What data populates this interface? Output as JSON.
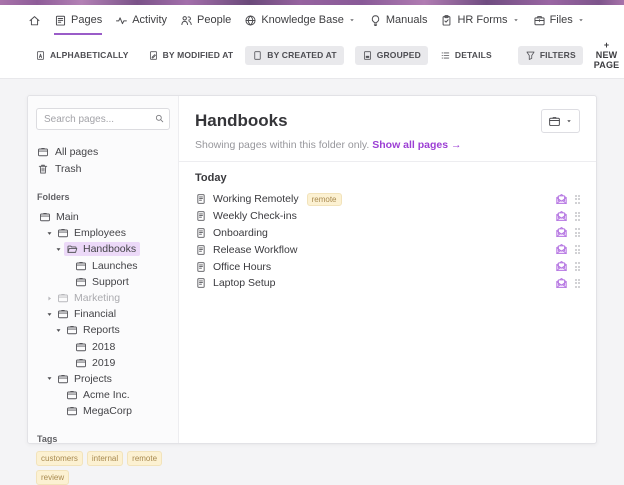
{
  "nav": {
    "items": [
      {
        "icon": "home",
        "label": "",
        "active": false,
        "dropdown": false
      },
      {
        "icon": "pages",
        "label": "Pages",
        "active": true,
        "dropdown": false
      },
      {
        "icon": "activity",
        "label": "Activity",
        "active": false,
        "dropdown": false
      },
      {
        "icon": "people",
        "label": "People",
        "active": false,
        "dropdown": false
      },
      {
        "icon": "globe",
        "label": "Knowledge Base",
        "active": false,
        "dropdown": true
      },
      {
        "icon": "bulb",
        "label": "Manuals",
        "active": false,
        "dropdown": false
      },
      {
        "icon": "clipboard",
        "label": "HR Forms",
        "active": false,
        "dropdown": true
      },
      {
        "icon": "files",
        "label": "Files",
        "active": false,
        "dropdown": true
      }
    ]
  },
  "toolbar": {
    "buttons": [
      {
        "icon": "sort-alpha",
        "label": "ALPHABETICALLY",
        "active": false
      },
      {
        "icon": "doc-modified",
        "label": "BY MODIFIED AT",
        "active": false
      },
      {
        "icon": "doc-blank",
        "label": "BY CREATED AT",
        "active": true
      },
      {
        "icon": "grouped",
        "label": "GROUPED",
        "active": true
      },
      {
        "icon": "list",
        "label": "DETAILS",
        "active": false
      },
      {
        "icon": "funnel",
        "label": "FILTERS",
        "active": true
      }
    ],
    "new_page_label": "+ NEW PAGE"
  },
  "sidebar": {
    "search_placeholder": "Search pages...",
    "items": [
      {
        "icon": "folder",
        "label": "All pages"
      },
      {
        "icon": "trash",
        "label": "Trash"
      }
    ],
    "folders_label": "Folders",
    "tree": [
      {
        "label": "Main",
        "level": 0,
        "arrow": null,
        "icon": "folder"
      },
      {
        "label": "Employees",
        "level": 1,
        "arrow": "down",
        "icon": "folder"
      },
      {
        "label": "Handbooks",
        "level": 2,
        "arrow": "down",
        "icon": "folder-open",
        "selected": true
      },
      {
        "label": "Launches",
        "level": 3,
        "arrow": null,
        "icon": "folder"
      },
      {
        "label": "Support",
        "level": 3,
        "arrow": null,
        "icon": "folder"
      },
      {
        "label": "Marketing",
        "level": 1,
        "arrow": "right",
        "icon": "folder",
        "dimmed": true
      },
      {
        "label": "Financial",
        "level": 1,
        "arrow": "down",
        "icon": "folder"
      },
      {
        "label": "Reports",
        "level": 2,
        "arrow": "down",
        "icon": "folder"
      },
      {
        "label": "2018",
        "level": 3,
        "arrow": null,
        "icon": "folder"
      },
      {
        "label": "2019",
        "level": 3,
        "arrow": null,
        "icon": "folder"
      },
      {
        "label": "Projects",
        "level": 1,
        "arrow": "down",
        "icon": "folder"
      },
      {
        "label": "Acme Inc.",
        "level": 2,
        "arrow": null,
        "icon": "folder"
      },
      {
        "label": "MegaCorp",
        "level": 2,
        "arrow": null,
        "icon": "folder"
      }
    ],
    "tags_label": "Tags",
    "tags": [
      "customers",
      "internal",
      "remote",
      "review"
    ]
  },
  "main": {
    "title": "Handbooks",
    "subtitle": "Showing pages within this folder only.",
    "link": "Show all pages →",
    "group_label": "Today",
    "rows": [
      {
        "title": "Working Remotely",
        "tag": "remote"
      },
      {
        "title": "Weekly Check-ins",
        "tag": null
      },
      {
        "title": "Onboarding",
        "tag": null
      },
      {
        "title": "Release Workflow",
        "tag": null
      },
      {
        "title": "Office Hours",
        "tag": null
      },
      {
        "title": "Laptop Setup",
        "tag": null
      }
    ]
  },
  "colors": {
    "accent": "#9a5cc8",
    "link": "#9c3fd4",
    "selected_bg": "#ecd9f8",
    "tag_bg": "#fcf1d2",
    "tag_text": "#a88a50",
    "envelope": "#b678e2"
  }
}
